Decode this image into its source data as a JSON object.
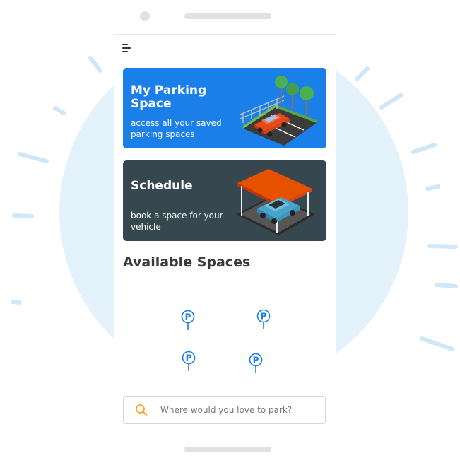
{
  "colors": {
    "accent_blue": "#1a7fe8",
    "card_dark": "#37474f",
    "backdrop_circle": "#e3f2fb",
    "pin_blue": "#1a7fe8",
    "search_icon": "#f5a623"
  },
  "header": {
    "menu_icon": "menu-icon"
  },
  "cards": [
    {
      "title": "My Parking Space",
      "subtitle": "access all your saved parking spaces",
      "illustration": "parked-car-icon"
    },
    {
      "title": "Schedule",
      "subtitle": "book a space for your vehicle",
      "illustration": "carport-icon"
    }
  ],
  "available": {
    "title": "Available Spaces",
    "pins": [
      {
        "label": "P"
      },
      {
        "label": "P"
      },
      {
        "label": "P"
      },
      {
        "label": "P"
      }
    ]
  },
  "search": {
    "placeholder": "Where would you love to park?",
    "value": "",
    "icon": "search-icon"
  }
}
